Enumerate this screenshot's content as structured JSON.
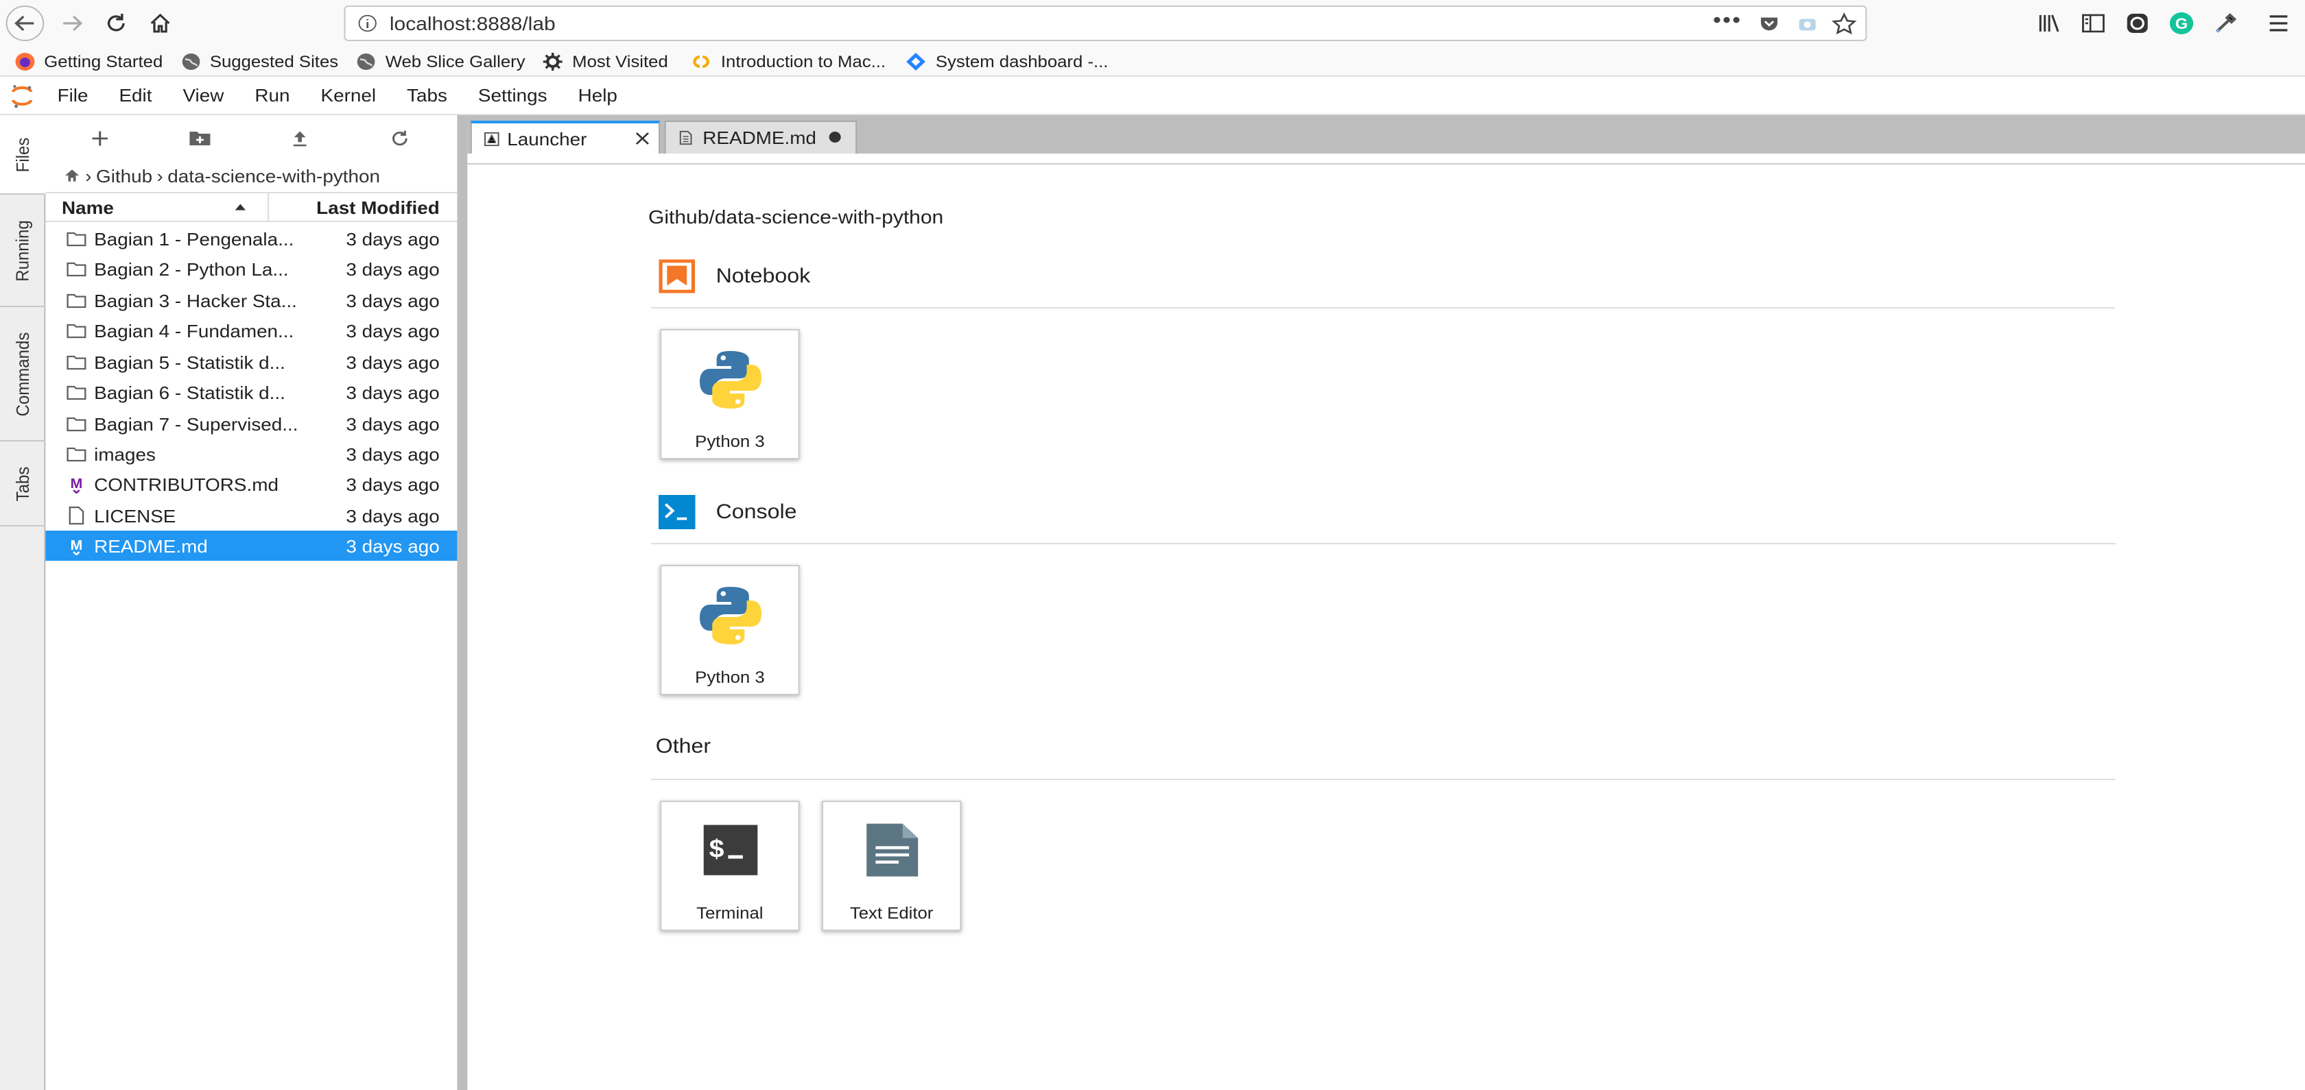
{
  "browser": {
    "url": "localhost:8888/lab",
    "bookmarks": [
      {
        "label": "Getting Started",
        "icon": "firefox-icon"
      },
      {
        "label": "Suggested Sites",
        "icon": "globe-icon"
      },
      {
        "label": "Web Slice Gallery",
        "icon": "globe-icon"
      },
      {
        "label": "Most Visited",
        "icon": "gear-icon"
      },
      {
        "label": "Introduction to Mac...",
        "icon": "colab-icon"
      },
      {
        "label": "System dashboard -...",
        "icon": "jira-icon"
      }
    ]
  },
  "menu": {
    "items": [
      "File",
      "Edit",
      "View",
      "Run",
      "Kernel",
      "Tabs",
      "Settings",
      "Help"
    ]
  },
  "sidetabs": [
    "Files",
    "Running",
    "Commands",
    "Tabs"
  ],
  "filebrowser": {
    "breadcrumb": [
      "Github",
      "data-science-with-python"
    ],
    "columns": {
      "name": "Name",
      "modified": "Last Modified"
    },
    "files": [
      {
        "name": "Bagian 1 - Pengenala...",
        "modified": "3 days ago",
        "type": "folder"
      },
      {
        "name": "Bagian 2 - Python La...",
        "modified": "3 days ago",
        "type": "folder"
      },
      {
        "name": "Bagian 3 - Hacker Sta...",
        "modified": "3 days ago",
        "type": "folder"
      },
      {
        "name": "Bagian 4 - Fundamen...",
        "modified": "3 days ago",
        "type": "folder"
      },
      {
        "name": "Bagian 5 - Statistik d...",
        "modified": "3 days ago",
        "type": "folder"
      },
      {
        "name": "Bagian 6 - Statistik d...",
        "modified": "3 days ago",
        "type": "folder"
      },
      {
        "name": "Bagian 7 - Supervised...",
        "modified": "3 days ago",
        "type": "folder"
      },
      {
        "name": "images",
        "modified": "3 days ago",
        "type": "folder"
      },
      {
        "name": "CONTRIBUTORS.md",
        "modified": "3 days ago",
        "type": "markdown"
      },
      {
        "name": "LICENSE",
        "modified": "3 days ago",
        "type": "file"
      },
      {
        "name": "README.md",
        "modified": "3 days ago",
        "type": "markdown",
        "selected": true
      }
    ]
  },
  "tabs": [
    {
      "label": "Launcher",
      "active": true
    },
    {
      "label": "README.md",
      "active": false
    }
  ],
  "launcher": {
    "path": "Github/data-science-with-python",
    "sections": {
      "notebook": {
        "title": "Notebook",
        "cards": [
          "Python 3"
        ]
      },
      "console": {
        "title": "Console",
        "cards": [
          "Python 3"
        ]
      },
      "other": {
        "title": "Other",
        "cards": [
          "Terminal",
          "Text Editor"
        ]
      }
    }
  },
  "colors": {
    "accent": "#2196f3",
    "notebook_icon": "#f37726",
    "console_icon": "#0288d1",
    "terminal_icon": "#3c3c3c",
    "editor_icon": "#5b7582"
  }
}
